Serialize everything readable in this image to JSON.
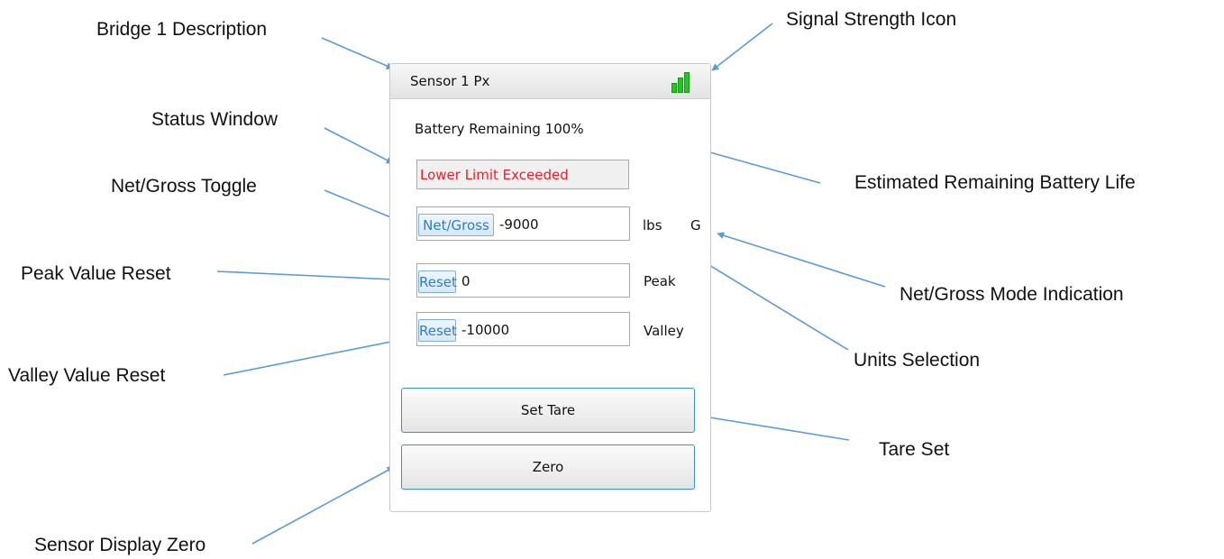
{
  "callouts": {
    "bridge_description": "Bridge 1 Description",
    "status_window": "Status Window",
    "net_gross_toggle": "Net/Gross Toggle",
    "peak_value_reset": "Peak Value Reset",
    "valley_value_reset": "Valley Value Reset",
    "sensor_display_zero": "Sensor Display Zero",
    "signal_strength_icon": "Signal Strength Icon",
    "estimated_battery_life": "Estimated Remaining Battery Life",
    "net_gross_mode_indication": "Net/Gross Mode Indication",
    "units_selection": "Units Selection",
    "tare_set": "Tare Set"
  },
  "panel": {
    "title": "Sensor 1 Px",
    "battery_text": "Battery Remaining 100%",
    "status_text": "Lower Limit Exceeded",
    "status_color": "#ee1c2a",
    "signal_color": "#26c526",
    "net_gross": {
      "button_label": "Net/Gross",
      "value": "-9000",
      "units": "lbs",
      "mode": "G"
    },
    "peak": {
      "button_label": "Reset",
      "value": "0",
      "label": "Peak"
    },
    "valley": {
      "button_label": "Reset",
      "value": "-10000",
      "label": "Valley"
    },
    "set_tare_label": "Set Tare",
    "zero_label": "Zero"
  },
  "accent_colors": {
    "arrow": "#5b9bd5",
    "button_border": "#3c8fd2",
    "mini_button_text": "#2f7dc5"
  }
}
